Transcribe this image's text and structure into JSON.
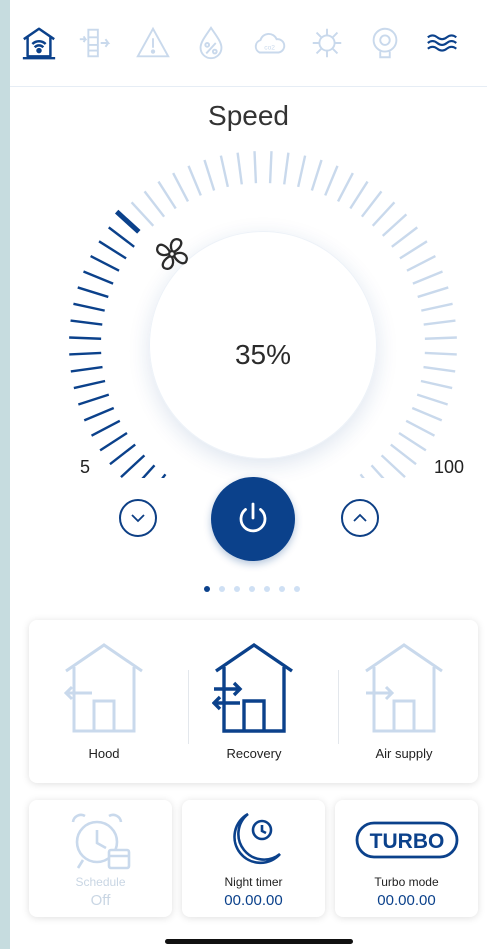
{
  "nav_icons": [
    {
      "name": "home-wifi-icon",
      "active": true
    },
    {
      "name": "ventilation-arrows-icon",
      "active": false
    },
    {
      "name": "warning-icon",
      "active": false
    },
    {
      "name": "humidity-icon",
      "active": false
    },
    {
      "name": "co2-cloud-icon",
      "active": false
    },
    {
      "name": "virus-icon",
      "active": false
    },
    {
      "name": "heater-icon",
      "active": false
    },
    {
      "name": "waves-icon",
      "active": false
    }
  ],
  "speed": {
    "title": "Speed",
    "value_label": "35%",
    "min_label": "5",
    "max_label": "100",
    "level_fraction": 0.35
  },
  "pager": {
    "total": 7,
    "active": 0
  },
  "modes": [
    {
      "label": "Hood",
      "active": false,
      "icon": "house-arrow-left-icon"
    },
    {
      "label": "Recovery",
      "active": true,
      "icon": "house-arrows-both-icon"
    },
    {
      "label": "Air supply",
      "active": false,
      "icon": "house-arrow-right-icon"
    }
  ],
  "cards": {
    "schedule": {
      "label": "Schedule",
      "value": "Off",
      "icon": "alarm-clock-calendar-icon"
    },
    "night_timer": {
      "label": "Night timer",
      "value": "00.00.00",
      "icon": "moon-clock-icon"
    },
    "turbo": {
      "label": "Turbo mode",
      "value": "00.00.00",
      "badge": "TURBO",
      "icon": "turbo-icon"
    }
  },
  "colors": {
    "accent": "#0b418b",
    "inactive": "#c9d9ec",
    "background": "#c6dcdf"
  }
}
